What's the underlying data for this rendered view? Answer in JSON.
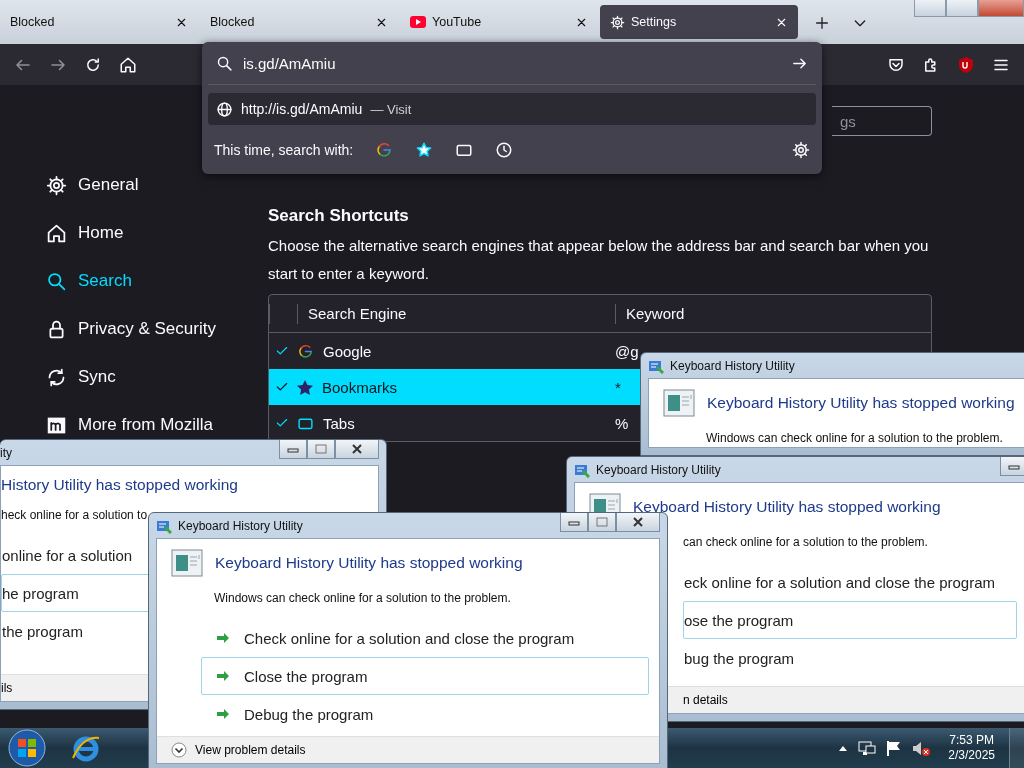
{
  "tabs": [
    {
      "label": "Blocked",
      "kind": "plain",
      "selected": false
    },
    {
      "label": "Blocked",
      "kind": "plain",
      "selected": false
    },
    {
      "label": "YouTube",
      "kind": "video",
      "selected": false
    },
    {
      "label": "Settings",
      "kind": "settings",
      "selected": true
    }
  ],
  "address_panel": {
    "value": "is.gd/AmAmiu",
    "suggestion_url": "http://is.gd/AmAmiu",
    "suggestion_action": "— Visit",
    "search_with_label": "This time, search with:",
    "engines": [
      {
        "kind": "google"
      },
      {
        "kind": "bookmarks"
      },
      {
        "kind": "tabs"
      },
      {
        "kind": "history"
      }
    ]
  },
  "find_field": {
    "placeholder": "gs"
  },
  "sidebar": {
    "items": [
      {
        "label": "General",
        "kind": "general",
        "selected": false
      },
      {
        "label": "Home",
        "kind": "home",
        "selected": false
      },
      {
        "label": "Search",
        "kind": "search",
        "selected": true
      },
      {
        "label": "Privacy & Security",
        "kind": "privacy",
        "selected": false
      },
      {
        "label": "Sync",
        "kind": "sync",
        "selected": false
      },
      {
        "label": "More from Mozilla",
        "kind": "mozilla",
        "selected": false
      }
    ]
  },
  "search_shortcuts": {
    "title": "Search Shortcuts",
    "description": "Choose the alternative search engines that appear below the address bar and search bar when you start to enter a keyword.",
    "columns": [
      "Search Engine",
      "Keyword"
    ],
    "rows": [
      {
        "kind": "google",
        "engine": "Google",
        "keyword": "@g",
        "checked": true,
        "selected": false
      },
      {
        "kind": "bookmarks",
        "engine": "Bookmarks",
        "keyword": "*",
        "checked": true,
        "selected": true
      },
      {
        "kind": "tabs",
        "engine": "Tabs",
        "keyword": "%",
        "checked": true,
        "selected": false
      }
    ]
  },
  "taskbar": {
    "time": "7:53 PM",
    "date": "2/3/2025",
    "volume_muted": true
  },
  "dialogs": [
    {
      "kind": "left-cut",
      "title": "ity",
      "heading": "History Utility has stopped working",
      "description": "heck online for a solution to",
      "options": [
        {
          "label": "online for a solution",
          "selected": false
        },
        {
          "label": "he program",
          "selected": true
        },
        {
          "label": "the program",
          "selected": false
        }
      ],
      "details": "ils"
    },
    {
      "kind": "full",
      "title": "Keyboard History Utility",
      "heading": "Keyboard History Utility has stopped working",
      "description": "Windows can check online for a solution to the problem."
    },
    {
      "kind": "offset",
      "title": "Keyboard History Utility",
      "heading": "Keyboard History Utility has stopped working",
      "description": "can check online for a solution to the problem.",
      "options": [
        {
          "label": "eck online for a solution and close the program",
          "selected": false
        },
        {
          "label": "ose the program",
          "selected": true
        },
        {
          "label": "bug the program",
          "selected": false
        }
      ],
      "details": "n details"
    },
    {
      "kind": "full",
      "title": "Keyboard History Utility",
      "heading": "Keyboard History Utility has stopped working",
      "description": "Windows can check online for a solution to the problem.",
      "options": [
        {
          "label": "Check online for a solution and close the program",
          "selected": false
        },
        {
          "label": "Close the program",
          "selected": true
        },
        {
          "label": "Debug the program",
          "selected": false
        }
      ],
      "details": "View problem details"
    }
  ]
}
